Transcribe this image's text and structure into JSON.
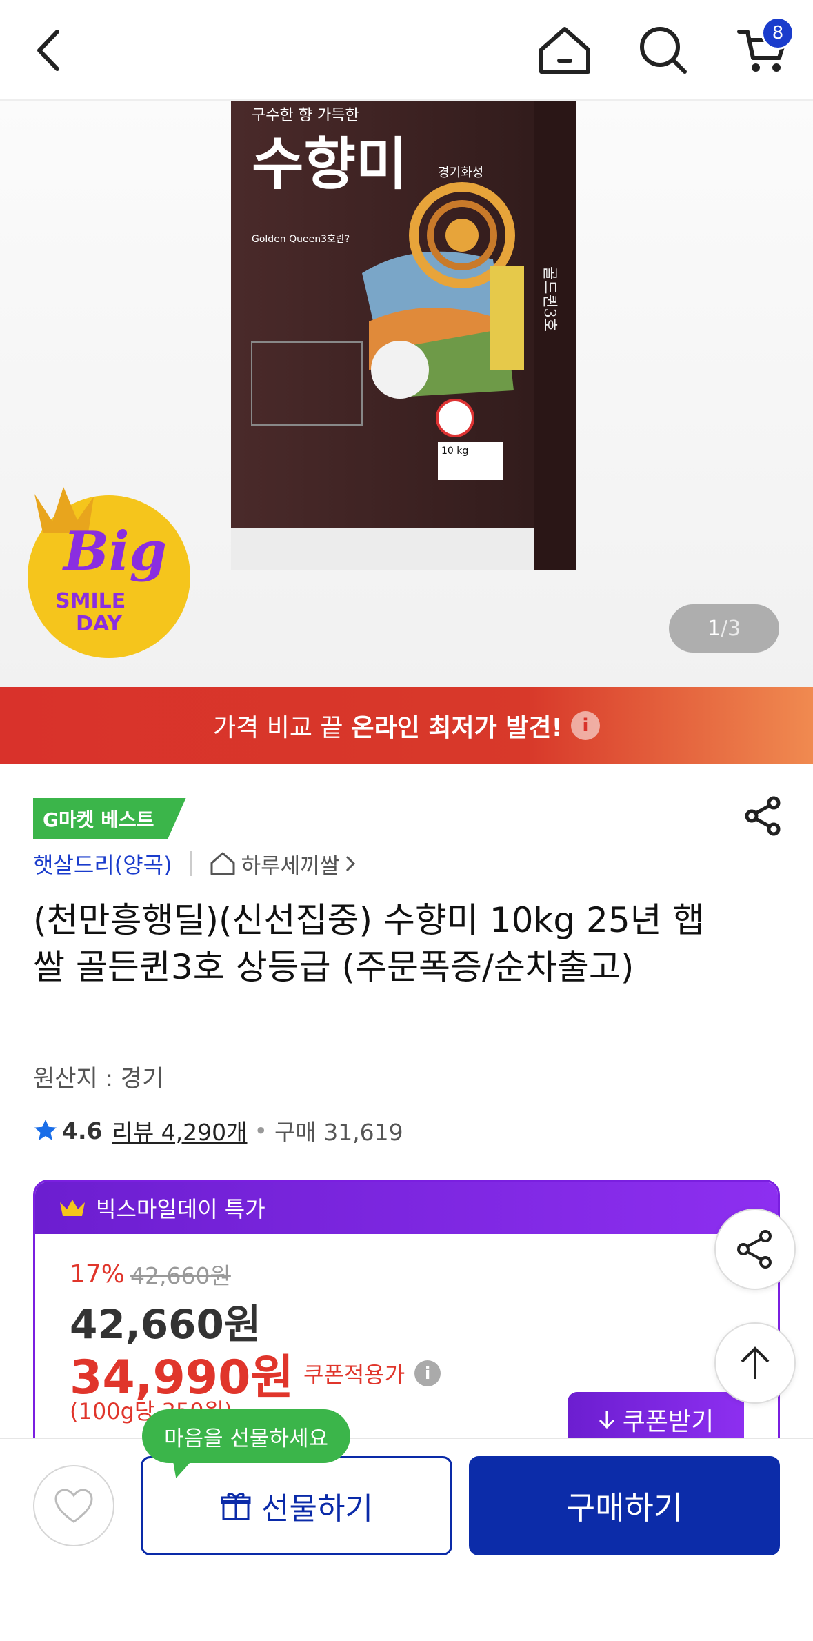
{
  "nav": {
    "cart_count": "8",
    "icons": [
      "back-icon",
      "home-icon",
      "search-icon",
      "cart-icon"
    ]
  },
  "hero": {
    "page_current": "1",
    "page_total": "/3",
    "bag_text": {
      "tagline": "구수한 향 가득한",
      "brand": "수향미",
      "region": "경기화성",
      "sub": "Golden Queen3호란?",
      "weight": "10 kg",
      "side": "골드퀸3호"
    },
    "badge": {
      "line1": "Big",
      "line2": "SMILE",
      "line3": "DAY"
    }
  },
  "banner": {
    "prefix": "가격 비교 끝",
    "emphasis": "온라인 최저가 발견!",
    "info": "i",
    "colors": {
      "start": "#d9322b",
      "end": "#f08a50"
    }
  },
  "product": {
    "best_badge": "G마켓 베스트",
    "seller": "햇살드리(양곡)",
    "store": "하루세끼쌀",
    "title": "(천만흥행딜)(신선집중) 수향미 10kg 25년 햅쌀 골든퀸3호 상등급 (주문폭증/순차출고)",
    "origin": "원산지 : 경기",
    "rating": "4.6",
    "review_label": "리뷰 4,290개",
    "purchase_label": "구매 31,619"
  },
  "deal": {
    "header": "빅스마일데이 특가",
    "discount_pct": "17%",
    "original_price": "42,660원",
    "sale_price": "42,660원",
    "coupon_price": "34,990원",
    "coupon_label": "쿠폰적용가",
    "unit_price": "(100g당 350원)",
    "coupon_button": "쿠폰받기",
    "colors": {
      "accent": "#7a1fe0",
      "price": "#e0352b"
    }
  },
  "bottom": {
    "tooltip": "마음을 선물하세요",
    "gift_button": "선물하기",
    "buy_button": "구매하기",
    "colors": {
      "primary": "#0c2ca9",
      "tooltip": "#3bb54a"
    }
  }
}
